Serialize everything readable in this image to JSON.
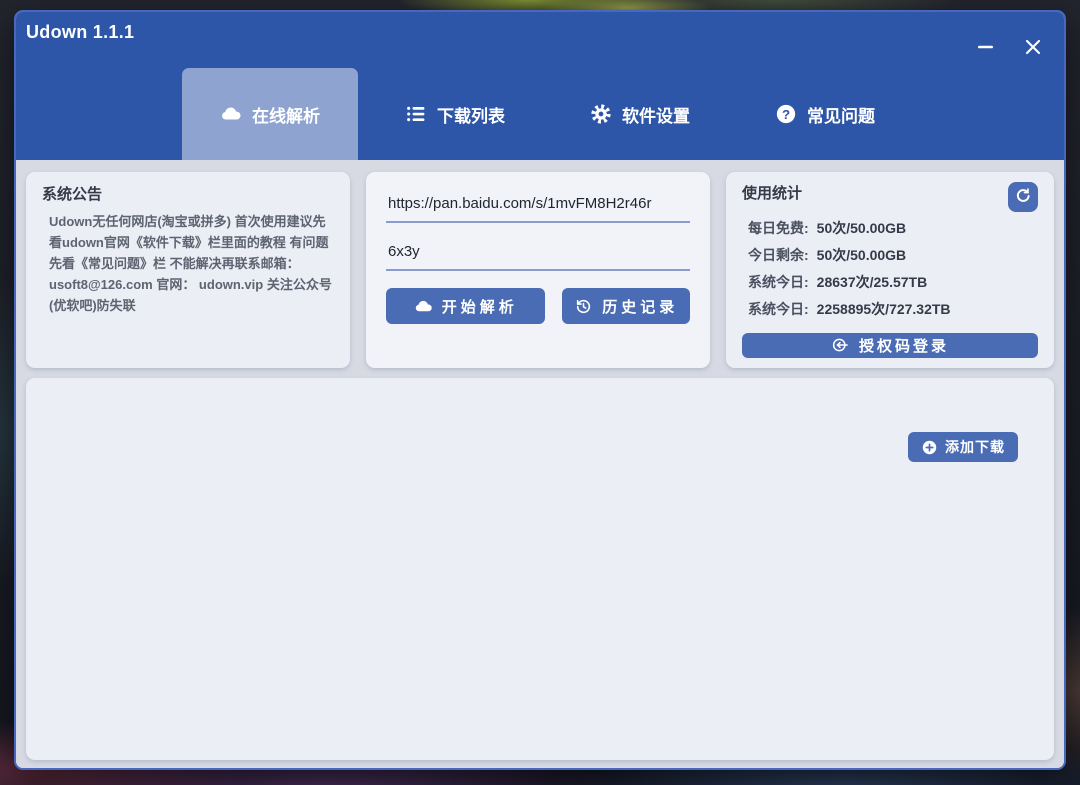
{
  "window": {
    "title": "Udown 1.1.1"
  },
  "tabs": [
    {
      "label": "在线解析",
      "icon": "cloud-icon",
      "active": true
    },
    {
      "label": "下载列表",
      "icon": "list-icon",
      "active": false
    },
    {
      "label": "软件设置",
      "icon": "gear-icon",
      "active": false
    },
    {
      "label": "常见问题",
      "icon": "question-icon",
      "active": false
    }
  ],
  "announcement": {
    "title": "系统公告",
    "body": "Udown无任何网店(淘宝或拼多) 首次使用建议先看udown官网《软件下载》栏里面的教程 有问题先看《常见问题》栏 不能解决再联系邮箱： usoft8@126.com 官网： udown.vip 关注公众号(优软吧)防失联"
  },
  "parse": {
    "url_value": "https://pan.baidu.com/s/1mvFM8H2r46r",
    "code_value": "6x3y",
    "start_button": "开始解析",
    "history_button": "历史记录"
  },
  "stats": {
    "title": "使用统计",
    "rows": [
      {
        "label": "每日免费:",
        "value": "50次/50.00GB"
      },
      {
        "label": "今日剩余:",
        "value": "50次/50.00GB"
      },
      {
        "label": "系统今日:",
        "value": "28637次/25.57TB"
      },
      {
        "label": "系统今日:",
        "value": "2258895次/727.32TB"
      }
    ],
    "login_button": "授权码登录"
  },
  "downloads": {
    "add_button": "添加下载"
  },
  "colors": {
    "header-blue": "#2d56a9",
    "active-tab": "#8ea3d0",
    "button-blue": "#4a6cb4",
    "border-blue": "#4868c0",
    "content-bg": "#d7dae3",
    "panel-bg": "#eceef5",
    "panel-bg-light": "#f1f3f9",
    "underline": "#8a9bce",
    "text-dark": "#343a47",
    "text-gray": "#5d6370",
    "input-text": "#20262f"
  }
}
